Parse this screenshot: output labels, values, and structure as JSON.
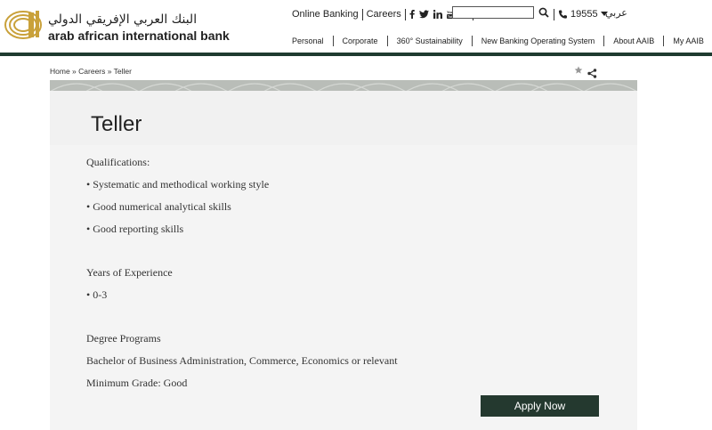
{
  "brand": {
    "name_ar": "البنك العربي الإفريقي الدولي",
    "name_en": "arab african international bank"
  },
  "topbar": {
    "online_banking": "Online Banking",
    "careers": "Careers",
    "social": [
      "f",
      "t",
      "in",
      "yt",
      "ig"
    ],
    "phone": "19555",
    "language": "عربي",
    "search": {
      "value": "",
      "placeholder": ""
    }
  },
  "nav": {
    "items": [
      "Personal",
      "Corporate",
      "360° Sustainability",
      "New Banking Operating System",
      "About AAIB",
      "My AAIB"
    ]
  },
  "breadcrumb": {
    "home": "Home",
    "sep1": " » ",
    "careers": "Careers",
    "sep2": " » ",
    "current": "Teller"
  },
  "page": {
    "title": "Teller",
    "qualifications_heading": "Qualifications:",
    "qualifications": [
      "•  Systematic and methodical working style",
      "• Good numerical analytical skills",
      "• Good reporting skills"
    ],
    "experience_heading": "Years of Experience",
    "experience": "•   0-3",
    "degree_heading": "Degree Programs",
    "degree": "Bachelor of Business Administration, Commerce, Economics or relevant",
    "min_grade": "Minimum Grade: Good",
    "apply_label": "Apply Now"
  },
  "colors": {
    "brand_dark_green": "#24392f",
    "header_rule": "#1f3b30",
    "logo_gold": "#c9a13a",
    "panel_bg": "#f1f1f1"
  }
}
